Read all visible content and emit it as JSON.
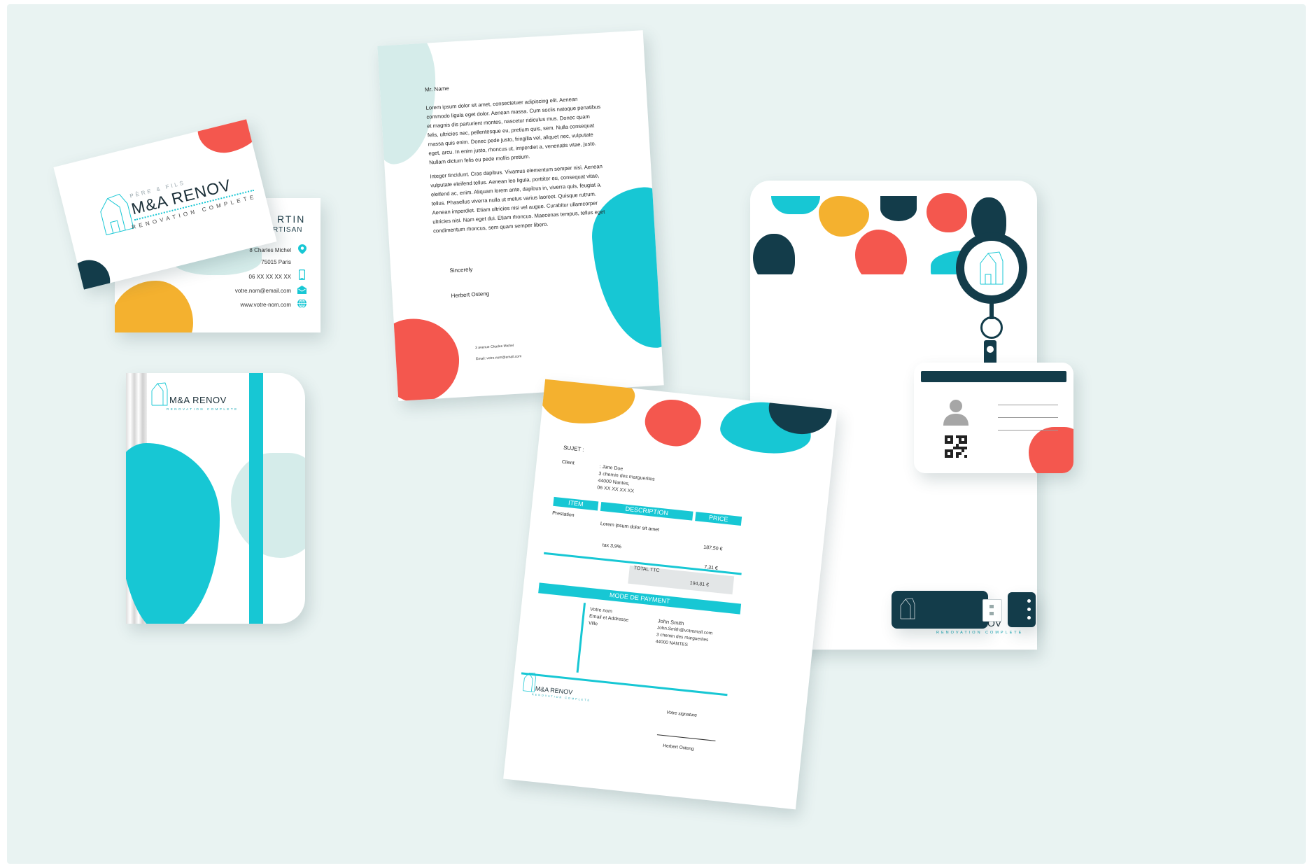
{
  "brand": {
    "tagline_top": "PÈRE & FILS",
    "name": "M&A RENOV",
    "tagline_bottom": "RENOVATION COMPLETE"
  },
  "colors": {
    "background": "#e9f3f2",
    "cyan": "#17c7d4",
    "coral": "#f4574e",
    "yellow": "#f4b12f",
    "navy": "#133c4a",
    "mint": "#cfe9e7"
  },
  "business_card": {
    "name_fragment": "RTIN",
    "title_fragment": "RTISAN",
    "address": "8 Charles Michel",
    "city": "75015 Paris",
    "phone": "06 XX XX XX XX",
    "email": "votre.nom@email.com",
    "website": "www.votre-nom.com",
    "icons": [
      "location-pin-icon",
      "phone-icon",
      "mail-icon",
      "globe-icon"
    ]
  },
  "letter": {
    "recipient": "Mr. Name",
    "paragraph1": "Lorem ipsum dolor sit amet, consectetuer adipiscing elit. Aenean commodo ligula eget dolor. Aenean massa. Cum sociis natoque penatibus et magnis dis parturient montes, nascetur ridiculus mus. Donec quam felis, ultricies nec, pellentesque eu, pretium quis, sem. Nulla consequat massa quis enim. Donec pede justo, fringilla vel, aliquet nec, vulputate eget, arcu. In enim justo, rhoncus ut, imperdiet a, venenatis vitae, justo. Nullam dictum felis eu pede mollis pretium.",
    "paragraph2": "Integer tincidunt. Cras dapibus. Vivamus elementum semper nisi. Aenean vulputate eleifend tellus. Aenean leo ligula, porttitor eu, consequat vitae, eleifend ac, enim. Aliquam lorem ante, dapibus in, viverra quis, feugiat a, tellus. Phasellus viverra nulla ut metus varius laoreet. Quisque rutrum. Aenean imperdiet. Etiam ultricies nisi vel augue. Curabitur ullamcorper ultricies nisi. Nam eget dui. Etiam rhoncus. Maecenas tempus, tellus eget condimentum rhoncus, sem quam semper libero.",
    "closing": "Sincerely",
    "signature": "Herbert Osteng",
    "footer_address": "3 avenue Charles Michel",
    "footer_email": "Email: votre.nom@email.com"
  },
  "invoice": {
    "subject_label": "SUJET :",
    "client_label": "Client",
    "client_lines": [
      ": Jane Doe",
      "3 chemin des marguerites",
      "44000 Nantes,",
      "06 XX XX XX XX"
    ],
    "headers": {
      "item": "ITEM",
      "description": "DESCRIPTION",
      "price": "PRICE"
    },
    "row_item": "Prestation",
    "row_description": "Lorem ipsum dolor sit amet",
    "row_price": "187,50 €",
    "tax_label": "tax 3,9%",
    "tax_value": "7,31 €",
    "total_label": "TOTAL TTC",
    "total_value": "194,81 €",
    "payment_header": "MODE DE PAYMENT",
    "payment_left": [
      "Votre nom",
      "Email et Addresse",
      "Ville"
    ],
    "payment_right": [
      "John Smith",
      "John.Smith@votremail.com",
      "3 chemin des marguerites",
      "44000 NANTES"
    ],
    "signature_label": "Votre signature",
    "signer": "Herbert Osteng"
  }
}
